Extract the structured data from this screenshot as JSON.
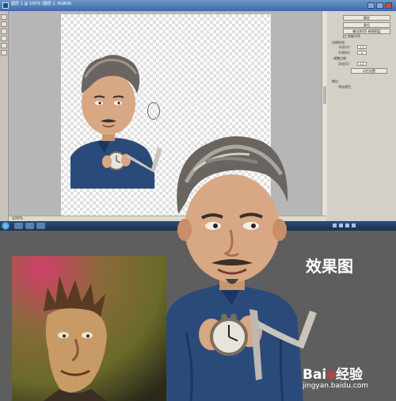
{
  "window": {
    "title": "图层 1 @ 100% (图层 1, RGB/8)"
  },
  "toolbar": {
    "tools": [
      "move-tool",
      "marquee-tool",
      "lasso-tool",
      "brush-tool",
      "eraser-tool",
      "zoom-tool"
    ]
  },
  "status": {
    "zoom": "100%"
  },
  "right_panel": {
    "btn_ok": "确定",
    "btn_cancel": "复位",
    "btn_output": "输出到(D) 新建图层",
    "chk_label": "智能半径",
    "section_label": "边缘检测",
    "radius_label": "半径(U):",
    "radius_value": "1.0",
    "smooth_label": "平滑(H):",
    "smooth_value": "0",
    "feather_label": "羽化(E):",
    "feather_value": "0.0",
    "adjust_label": "调整边缘",
    "output_label": "输出",
    "clean_label": "净化颜色",
    "save_btn": "记住设置"
  },
  "result": {
    "label": "效果图"
  },
  "watermark": {
    "brand_left": "Bai",
    "brand_paw": "❁",
    "brand_right": "经验",
    "url": "jingyan.baidu.com"
  },
  "colors": {
    "shirt": "#2a4a7a",
    "hair": "#6a6560",
    "skin": "#d8a784",
    "background": "#5e5e5e"
  }
}
